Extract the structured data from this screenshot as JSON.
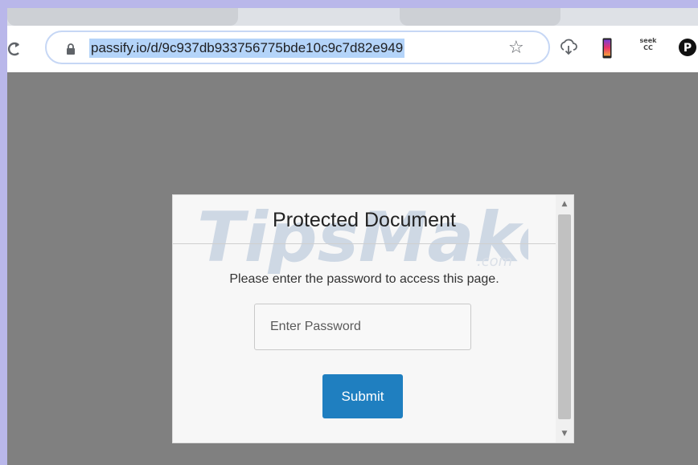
{
  "browser": {
    "url": "passify.io/d/9c937db933756775bde10c9c7d82e949",
    "extensions": {
      "seek_label_top": "seek",
      "seek_label_bottom": "CC",
      "p_label": "P"
    }
  },
  "dialog": {
    "title": "Protected Document",
    "prompt": "Please enter the password to access this page.",
    "password_placeholder": "Enter Password",
    "submit_label": "Submit"
  },
  "watermark": {
    "text": "TipsMake",
    "suffix": ".com"
  },
  "colors": {
    "submit_button": "#1f7fc0",
    "url_highlight": "#b4d4f9",
    "page_background": "#808080"
  }
}
